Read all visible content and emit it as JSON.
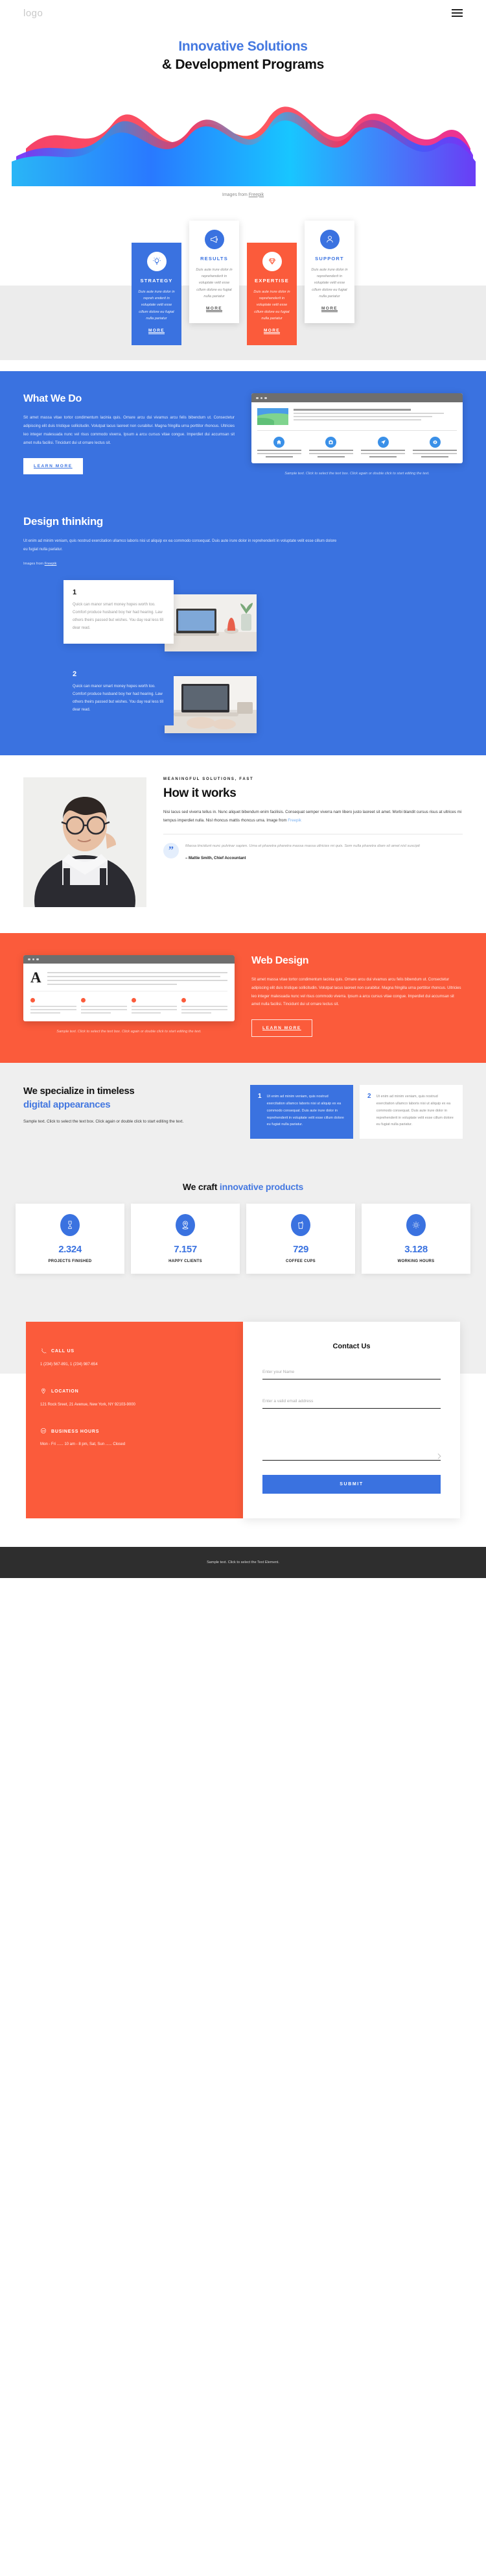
{
  "header": {
    "logo": "logo",
    "menu_icon": "hamburger-menu"
  },
  "hero": {
    "title_line1": "Innovative Solutions",
    "title_line2": "& Development Programs",
    "credit_prefix": "Images from ",
    "credit_link": "Freepik"
  },
  "feature_cards": [
    {
      "icon": "lightbulb-icon",
      "title": "STRATEGY",
      "text": "Duis aute irure dolor in repreh enderit in voluptate velit esse cillum dolore eu fugiat nulla pariatur",
      "more": "MORE",
      "style": "blue"
    },
    {
      "icon": "megaphone-icon",
      "title": "RESULTS",
      "text": "Duis aute irure dolor in reprehenderit in voluptate velit esse cillum dolore eu fugiat nulla pariatur",
      "more": "MORE",
      "style": "white"
    },
    {
      "icon": "diamond-icon",
      "title": "EXPERTISE",
      "text": "Duis aute irure dolor in reprehenderit in voluptate velit esse cillum dolore eu fugiat nulla pariatur",
      "more": "MORE",
      "style": "orange"
    },
    {
      "icon": "user-icon",
      "title": "SUPPORT",
      "text": "Duis aute irure dolor in reprehenderit in voluptate velit esse cillum dolore eu fugiat nulla pariatur",
      "more": "MORE",
      "style": "white"
    }
  ],
  "what_we_do": {
    "title": "What We Do",
    "body": "Sit amet massa vitae tortor condimentum lacinia quis. Ornare arcu dui vivamus arcu felis bibendum ut. Consectetur adipiscing elit duis tristique sollicitudin. Volutpat lacus laoreet non curabitur. Magna fringilla urna porttitor rhoncus. Ultricies leo integer malesuada nunc vel risus commodo viverra. Ipsum a arcu cursus vitae congue. Imperdiet dui accumsan sit amet nulla facilisi. Tincidunt dui ut ornare lectus sit.",
    "button": "LEARN MORE",
    "mock_caption": "Sample text. Click to select the text box. Click again or double click to start editing the text."
  },
  "design_thinking": {
    "title": "Design thinking",
    "body": "Ut enim ad minim veniam, quis nostrud exercitation ullamco laboris nisi ut aliquip ex ea commodo consequat. Duis aute irure dolor in reprehenderit in voluptate velit esse cillum dolore eu fugiat nulla pariatur.",
    "credit_prefix": "Images from ",
    "credit_link": "Freepik",
    "cards": [
      {
        "number": "1",
        "text": "Quick can manor smart money hopes worth too. Comfort produce husband boy her had hearing. Law others theirs passed but wishes. You day real less till dear read."
      },
      {
        "number": "2",
        "text": "Quick can manor smart money hopes worth too. Comfort produce husband boy her had hearing. Law others theirs passed but wishes. You day real less till dear read."
      }
    ]
  },
  "how_it_works": {
    "eyebrow": "MEANINGFUL SOLUTIONS, FAST",
    "title": "How it works",
    "body": "Nisi lacus sed viverra tellus in. Nunc aliquet bibendum enim facilisis. Consequat semper viverra nam libero justo laoreet sit amet. Morbi blandit cursus risus at ultrices mi tempus imperdiet nulla. Nisl rhoncus mattis rhoncus urna. ",
    "credit_prefix": "Image from ",
    "credit_link": "Freepik",
    "quote": "Massa tincidunt nunc pulvinar sapien. Urna et pharetra pharetra massa massa ultricies mi quis. Sem nulla pharetra diam sit amet nisl suscipit",
    "author": "– Mattie Smith, Chief Accountant"
  },
  "web_design": {
    "title": "Web Design",
    "body": "Sit amet massa vitae tortor condimentum lacinia quis. Ornare arcu dui vivamus arcu felis bibendum ut. Consectetur adipiscing elit duis tristique sollicitudin. Volutpat lacus laoreet non curabitur. Magna fringilla urna porttitor rhoncus. Ultricies leo integer malesuada nunc vel risus commodo viverra. Ipsum a arcu cursus vitae congue. Imperdiet dui accumsan sit amet nulla facilisi. Tincidunt dui ut ornare lectus sit.",
    "button": "LEARN MORE",
    "mock_caption": "Sample text. Click to select the text box. Click again or double click to start editing the text.",
    "mock_letter": "A"
  },
  "specialize": {
    "title_dark": "We specialize in timeless",
    "title_accent": "digital appearances",
    "sub": "Sample text. Click to select the text box. Click again or double click to start editing the text.",
    "cards": [
      {
        "number": "1",
        "text": "Ut enim ad minim veniam, quis nostrud exercitation ullamco laboris nisi ut aliquip ex ea commodo consequat. Duis aute irure dolor in reprehenderit in voluptate velit esse cillum dolore eu fugiat nulla pariatur."
      },
      {
        "number": "2",
        "text": "Ut enim ad minim veniam, quis nostrud exercitation ullamco laboris nisi ut aliquip ex ea commodo consequat. Duis aute irure dolor in reprehenderit in voluptate velit esse cillum dolore eu fugiat nulla pariatur."
      }
    ]
  },
  "stats": {
    "title_dark": "We craft ",
    "title_accent": "innovative products",
    "items": [
      {
        "icon": "trophy-icon",
        "number": "2.324",
        "label": "PROJECTS FINISHED"
      },
      {
        "icon": "map-pin-icon",
        "number": "7.157",
        "label": "HAPPY CLIENTS"
      },
      {
        "icon": "cup-icon",
        "number": "729",
        "label": "COFFEE CUPS"
      },
      {
        "icon": "gear-icon",
        "number": "3.128",
        "label": "WORKING HOURS"
      }
    ]
  },
  "contact": {
    "info": [
      {
        "icon": "phone-icon",
        "label": "CALL US",
        "value": "1 (234) 567-891, 1 (234) 987-654"
      },
      {
        "icon": "map-pin-icon",
        "label": "LOCATION",
        "value": "121 Rock Sreet, 21 Avenue, New York, NY 92103-9000"
      },
      {
        "icon": "clock-24-icon",
        "label": "BUSINESS HOURS",
        "value": "Mon - Fri ...... 10 am - 8 pm, Sat, Sun ...... Closed"
      }
    ],
    "form_title": "Contact Us",
    "name_placeholder": "Enter your Name",
    "email_placeholder": "Enter a valid email address",
    "message_placeholder": "",
    "submit_label": "SUBMIT"
  },
  "footer": {
    "text": "Sample text. Click to select the Text Element."
  },
  "colors": {
    "blue": "#3a72e0",
    "orange": "#fb5b3b",
    "accent_blue": "#4478e0",
    "grey": "#efefef",
    "footer": "#2e2e2e"
  }
}
